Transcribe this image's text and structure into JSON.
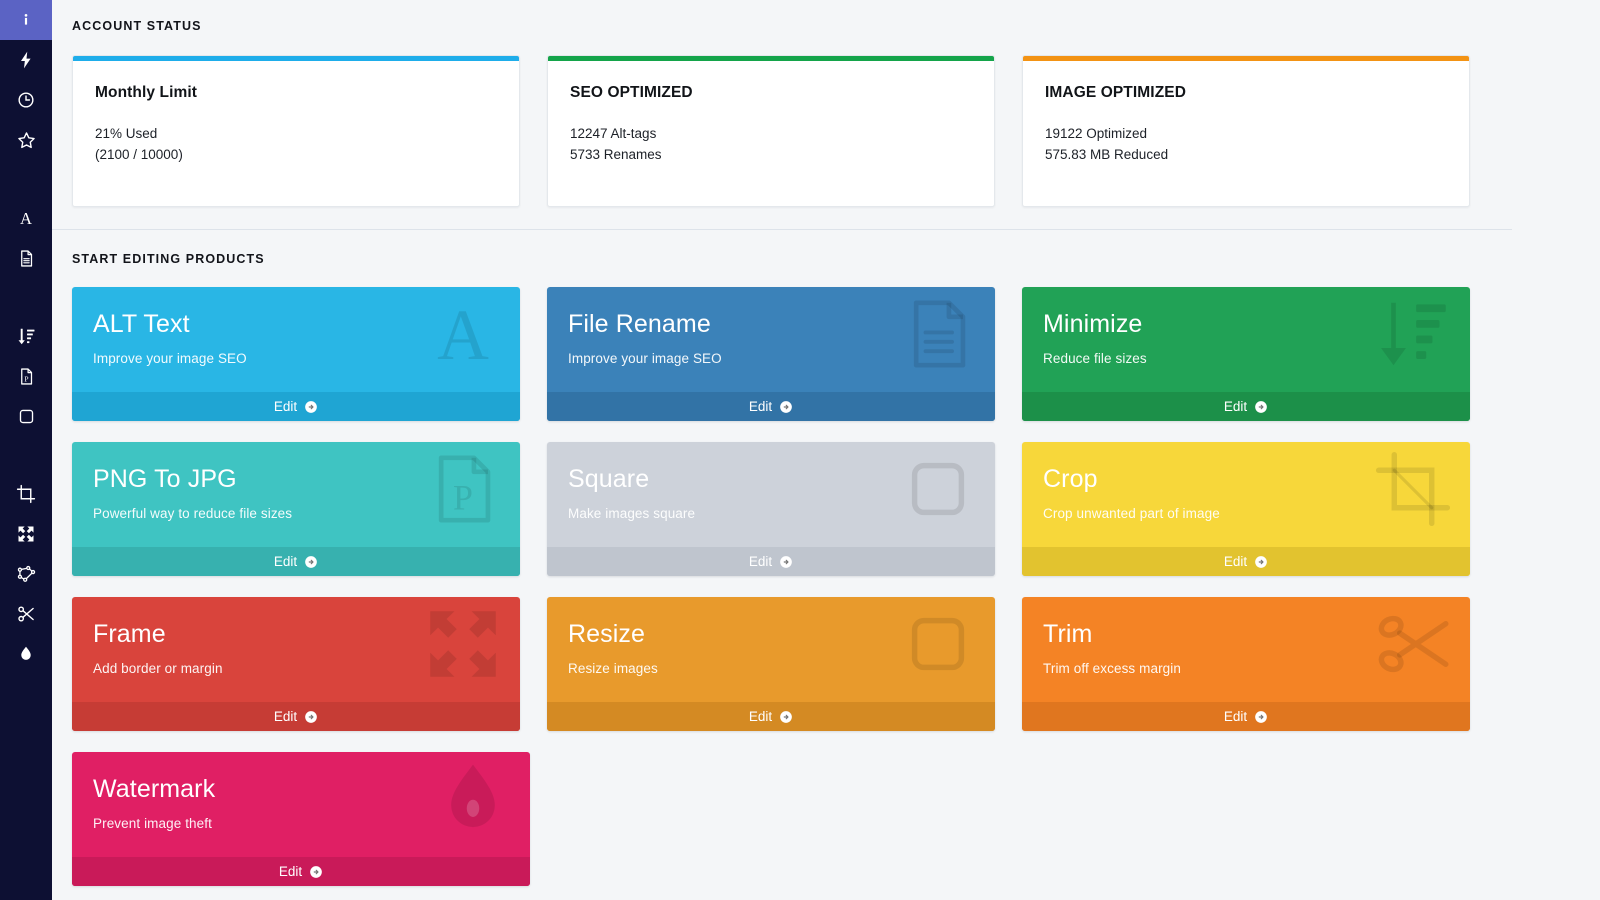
{
  "sidebar": {
    "items": [
      {
        "name": "info",
        "icon": "info-icon",
        "active": true
      },
      {
        "name": "bolt",
        "icon": "bolt-icon",
        "active": false
      },
      {
        "name": "history",
        "icon": "clock-icon",
        "active": false
      },
      {
        "name": "favorites",
        "icon": "star-icon",
        "active": false
      },
      {
        "name": "alt-text",
        "icon": "letter-a-icon",
        "active": false
      },
      {
        "name": "file-rename",
        "icon": "document-icon",
        "active": false
      },
      {
        "name": "minimize",
        "icon": "sort-descending-icon",
        "active": false
      },
      {
        "name": "png-to-jpg",
        "icon": "document-p-icon",
        "active": false
      },
      {
        "name": "square",
        "icon": "rounded-square-icon",
        "active": false
      },
      {
        "name": "crop",
        "icon": "crop-icon",
        "active": false
      },
      {
        "name": "frame",
        "icon": "expand-arrows-icon",
        "active": false
      },
      {
        "name": "resize",
        "icon": "resize-handles-icon",
        "active": false
      },
      {
        "name": "trim",
        "icon": "scissors-icon",
        "active": false
      },
      {
        "name": "watermark",
        "icon": "water-drop-icon",
        "active": false
      }
    ]
  },
  "account_status": {
    "heading": "ACCOUNT STATUS",
    "cards": [
      {
        "title": "Monthly Limit",
        "line1": "21% Used",
        "line2": "(2100 / 10000)",
        "accent": "#1eadea"
      },
      {
        "title": "SEO OPTIMIZED",
        "line1": "12247 Alt-tags",
        "line2": "5733 Renames",
        "accent": "#14a44a"
      },
      {
        "title": "IMAGE OPTIMIZED",
        "line1": "19122 Optimized",
        "line2": "575.83 MB Reduced",
        "accent": "#f39314"
      }
    ]
  },
  "products": {
    "heading": "START EDITING PRODUCTS",
    "edit_label": "Edit",
    "tiles": [
      {
        "title": "ALT Text",
        "subtitle": "Improve your image SEO",
        "icon": "letter-a-icon",
        "bg": "#29b6e5",
        "footer_bg": "#1fa5d3",
        "edit_label": "Edit"
      },
      {
        "title": "File Rename",
        "subtitle": "Improve your image SEO",
        "icon": "document-icon",
        "bg": "#3b82b9",
        "footer_bg": "#3273a6",
        "edit_label": "Edit"
      },
      {
        "title": "Minimize",
        "subtitle": "Reduce file sizes",
        "icon": "sort-descending-icon",
        "bg": "#21a256",
        "footer_bg": "#1c9049",
        "edit_label": "Edit"
      },
      {
        "title": "PNG To JPG",
        "subtitle": "Powerful way to reduce file sizes",
        "icon": "document-p-icon",
        "bg": "#3fc4c2",
        "footer_bg": "#37b1af",
        "edit_label": "Edit"
      },
      {
        "title": "Square",
        "subtitle": "Make images square",
        "icon": "rounded-square-icon",
        "bg": "#cdd2da",
        "footer_bg": "#bfc5ce",
        "edit_label": "Edit"
      },
      {
        "title": "Crop",
        "subtitle": "Crop unwanted part of image",
        "icon": "crop-icon",
        "bg": "#f7d73a",
        "footer_bg": "#e2c32f",
        "edit_label": "Edit"
      },
      {
        "title": "Frame",
        "subtitle": "Add border or margin",
        "icon": "expand-arrows-icon",
        "bg": "#d9443c",
        "footer_bg": "#c63c35",
        "edit_label": "Edit"
      },
      {
        "title": "Resize",
        "subtitle": "Resize images",
        "icon": "rounded-square-icon",
        "bg": "#e89a2c",
        "footer_bg": "#d48a23",
        "edit_label": "Edit"
      },
      {
        "title": "Trim",
        "subtitle": "Trim off excess margin",
        "icon": "scissors-icon",
        "bg": "#f48325",
        "footer_bg": "#e0761f",
        "edit_label": "Edit"
      },
      {
        "title": "Watermark",
        "subtitle": "Prevent image theft",
        "icon": "water-drop-icon",
        "bg": "#e01f64",
        "footer_bg": "#c91a59",
        "edit_label": "Edit"
      }
    ]
  }
}
